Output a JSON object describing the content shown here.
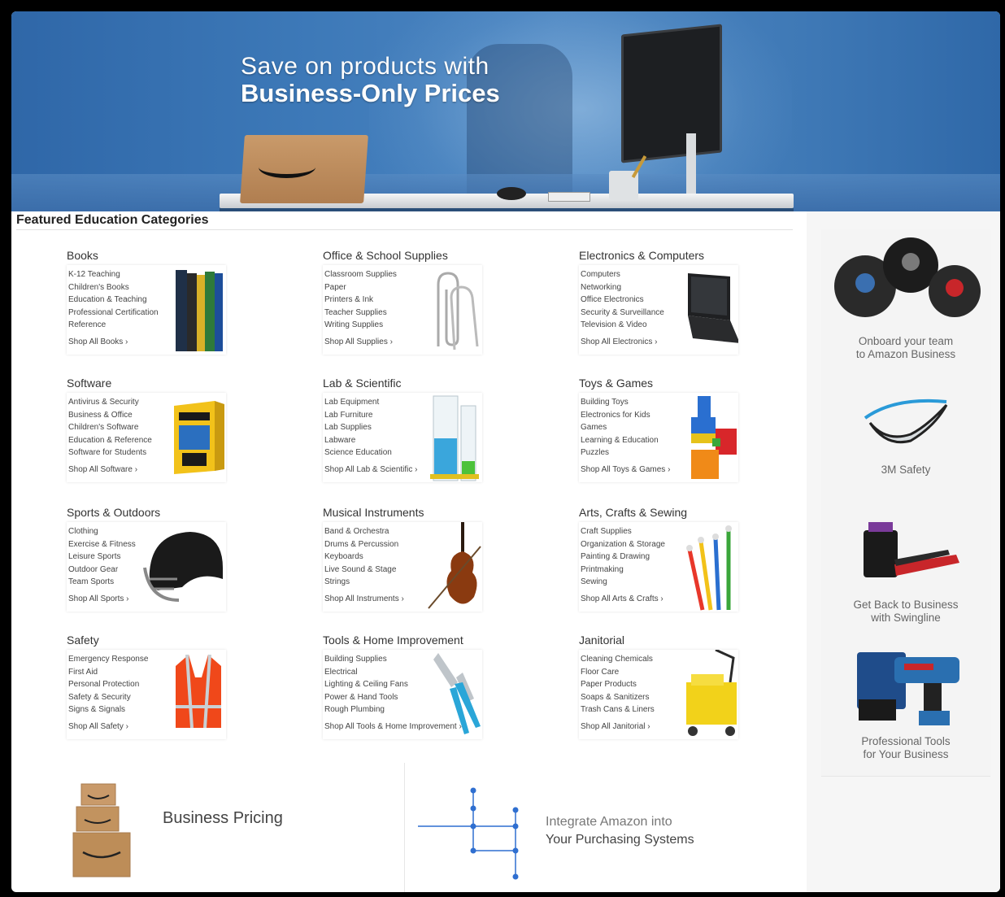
{
  "hero": {
    "line1": "Save on products with",
    "line2": "Business-Only Prices"
  },
  "section_title": "Featured Education Categories",
  "categories": [
    {
      "title": "Books",
      "links": [
        "K-12 Teaching",
        "Children's Books",
        "Education & Teaching",
        "Professional Certification",
        "Reference"
      ],
      "shop_all": "Shop All Books ›",
      "icon": "books-icon"
    },
    {
      "title": "Office & School Supplies",
      "links": [
        "Classroom Supplies",
        "Paper",
        "Printers & Ink",
        "Teacher Supplies",
        "Writing Supplies"
      ],
      "shop_all": "Shop All Supplies ›",
      "icon": "paperclip-icon"
    },
    {
      "title": "Electronics & Computers",
      "links": [
        "Computers",
        "Networking",
        "Office Electronics",
        "Security & Surveillance",
        "Television & Video"
      ],
      "shop_all": "Shop All Electronics ›",
      "icon": "laptop-icon"
    },
    {
      "title": "Software",
      "links": [
        "Antivirus & Security",
        "Business & Office",
        "Children's Software",
        "Education & Reference",
        "Software for Students"
      ],
      "shop_all": "Shop All Software ›",
      "icon": "software-box-icon"
    },
    {
      "title": "Lab & Scientific",
      "links": [
        "Lab Equipment",
        "Lab Furniture",
        "Lab Supplies",
        "Labware",
        "Science Education"
      ],
      "shop_all": "Shop All Lab & Scientific ›",
      "icon": "test-tube-icon"
    },
    {
      "title": "Toys & Games",
      "links": [
        "Building Toys",
        "Electronics for Kids",
        "Games",
        "Learning & Education",
        "Puzzles"
      ],
      "shop_all": "Shop All Toys & Games ›",
      "icon": "building-blocks-icon"
    },
    {
      "title": "Sports & Outdoors",
      "links": [
        "Clothing",
        "Exercise & Fitness",
        "Leisure Sports",
        "Outdoor Gear",
        "Team Sports"
      ],
      "shop_all": "Shop All Sports ›",
      "icon": "helmet-icon"
    },
    {
      "title": "Musical Instruments",
      "links": [
        "Band & Orchestra",
        "Drums & Percussion",
        "Keyboards",
        "Live Sound & Stage",
        "Strings"
      ],
      "shop_all": "Shop All Instruments ›",
      "icon": "violin-icon"
    },
    {
      "title": "Arts, Crafts & Sewing",
      "links": [
        "Craft Supplies",
        "Organization & Storage",
        "Painting & Drawing",
        "Printmaking",
        "Sewing"
      ],
      "shop_all": "Shop All Arts & Crafts ›",
      "icon": "paintbrush-icon"
    },
    {
      "title": "Safety",
      "links": [
        "Emergency Response",
        "First Aid",
        "Personal Protection",
        "Safety & Security",
        "Signs & Signals"
      ],
      "shop_all": "Shop All Safety ›",
      "icon": "safety-vest-icon"
    },
    {
      "title": "Tools & Home Improvement",
      "links": [
        "Building Supplies",
        "Electrical",
        "Lighting & Ceiling Fans",
        "Power & Hand Tools",
        "Rough Plumbing"
      ],
      "shop_all": "Shop All Tools & Home Improvement ›",
      "icon": "pliers-icon"
    },
    {
      "title": "Janitorial",
      "links": [
        "Cleaning Chemicals",
        "Floor Care",
        "Paper Products",
        "Soaps & Sanitizers",
        "Trash Cans & Liners"
      ],
      "shop_all": "Shop All Janitorial ›",
      "icon": "mop-bucket-icon"
    }
  ],
  "sidebar": [
    {
      "line1": "Onboard your team",
      "line2": "to Amazon Business",
      "icon": "team-icon"
    },
    {
      "line1": "3M Safety",
      "line2": "",
      "icon": "safety-glasses-icon"
    },
    {
      "line1": "Get Back to Business",
      "line2": "with Swingline",
      "icon": "stapler-icon"
    },
    {
      "line1": "Professional Tools",
      "line2": "for Your Business",
      "icon": "drill-icon"
    }
  ],
  "promos": {
    "business_pricing": "Business Pricing",
    "integrate_line1": "Integrate Amazon into",
    "integrate_line2": "Your Purchasing Systems"
  },
  "colors": {
    "hero_blue": "#3d79b8",
    "box_brown": "#c99a6a",
    "network_blue": "#2f6fd0"
  }
}
